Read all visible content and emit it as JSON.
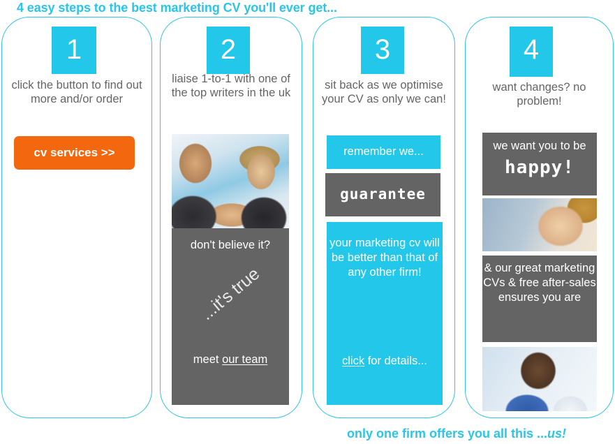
{
  "colors": {
    "cyan": "#22c7e9",
    "orange": "#f3680f",
    "grey": "#646464",
    "text_grey": "#656565",
    "white": "#ffffff"
  },
  "headline": "4 easy steps to the best marketing CV you'll ever get...",
  "footline_text": "only one firm offers you all this ...",
  "footline_emphasis": "us!",
  "steps": [
    {
      "number": "1",
      "caption": "click the button to find out more and/or order",
      "cta_label": "cv services >>"
    },
    {
      "number": "2",
      "caption": "liaise 1-to-1 with one of the top writers in the uk",
      "photo_icon": "business-people-photo",
      "box": {
        "line1": "don't believe it?",
        "diagonal": "...it's true",
        "footer_prefix": "meet ",
        "footer_link": "our team"
      }
    },
    {
      "number": "3",
      "caption": "sit back as we optimise your CV as only we can!",
      "box_a": "remember we...",
      "box_b": "guarantee",
      "box_c": {
        "paragraph": "your marketing cv will be better than that of any other firm!",
        "link": "click",
        "link_suffix": " for details..."
      }
    },
    {
      "number": "4",
      "caption": "want changes? no problem!",
      "box_a": {
        "line1": "we want you to be",
        "line2": "happy!"
      },
      "photo_top_icon": "smiling-woman-photo",
      "box_b": "& our great marketing CVs & free after-sales ensures you are",
      "photo_bottom_icon": "smiling-man-photo"
    }
  ]
}
